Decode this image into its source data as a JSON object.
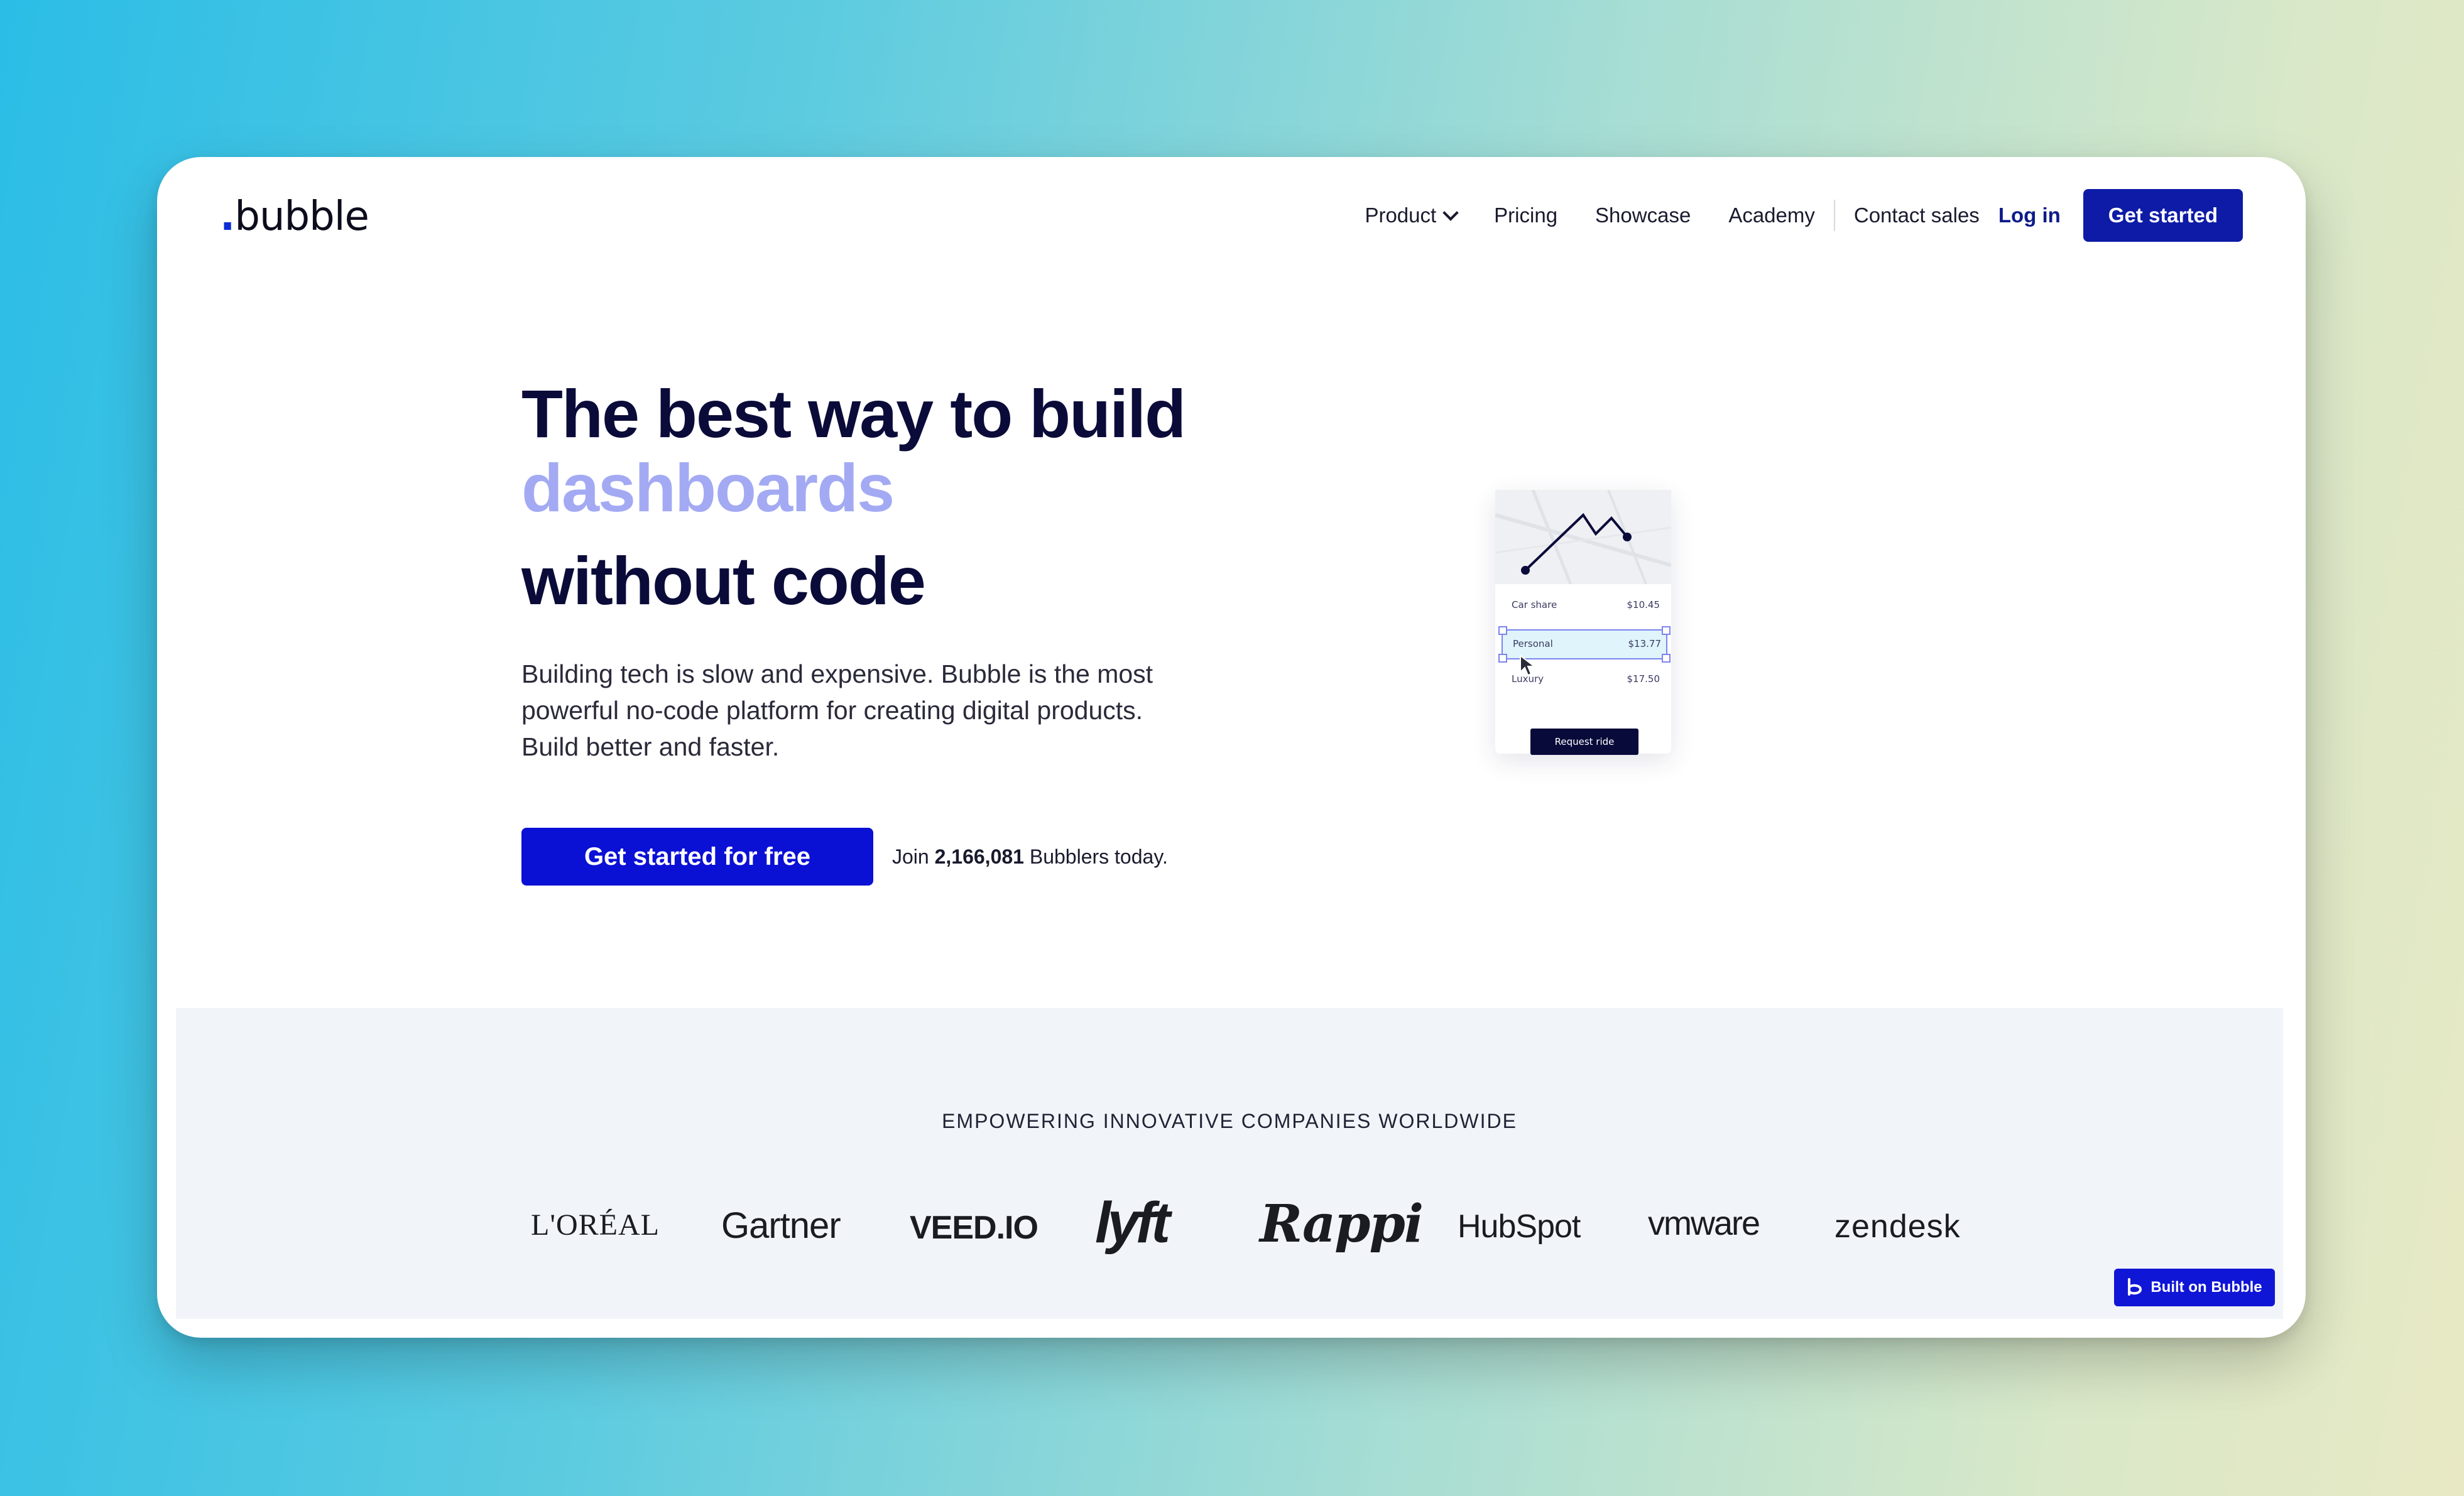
{
  "nav": {
    "logo_dot": ".",
    "logo_text": "bubble",
    "items": [
      "Product",
      "Pricing",
      "Showcase",
      "Academy",
      "Contact sales"
    ],
    "login": "Log in",
    "get_started": "Get started"
  },
  "hero": {
    "title_line1": "The best way to build",
    "title_accent": "dashboards",
    "title_line3": "without code",
    "subtitle": "Building tech is slow and expensive. Bubble is the most powerful no-code platform for creating digital products. Build better and faster.",
    "cta": "Get started for free",
    "join_prefix": "Join ",
    "join_count": "2,166,081",
    "join_suffix": " Bubblers today."
  },
  "mockup": {
    "rows": [
      {
        "name": "Car share",
        "price": "$10.45"
      },
      {
        "name": "Personal",
        "price": "$13.77"
      },
      {
        "name": "Luxury",
        "price": "$17.50"
      }
    ],
    "button": "Request ride"
  },
  "logos": {
    "heading": "EMPOWERING INNOVATIVE COMPANIES WORLDWIDE",
    "brands": [
      "L'ORÉAL",
      "Gartner",
      "VEED.IO",
      "lyft",
      "Rappi",
      "HubSpot",
      "vmware",
      "zendesk"
    ]
  },
  "badge": {
    "label": "Built on Bubble"
  },
  "colors": {
    "primary": "#0b10d5",
    "nav_button": "#0d1ba6",
    "heading": "#0b0b3a",
    "accent": "#a3aaf3",
    "logos_bg": "#f1f5f9"
  }
}
